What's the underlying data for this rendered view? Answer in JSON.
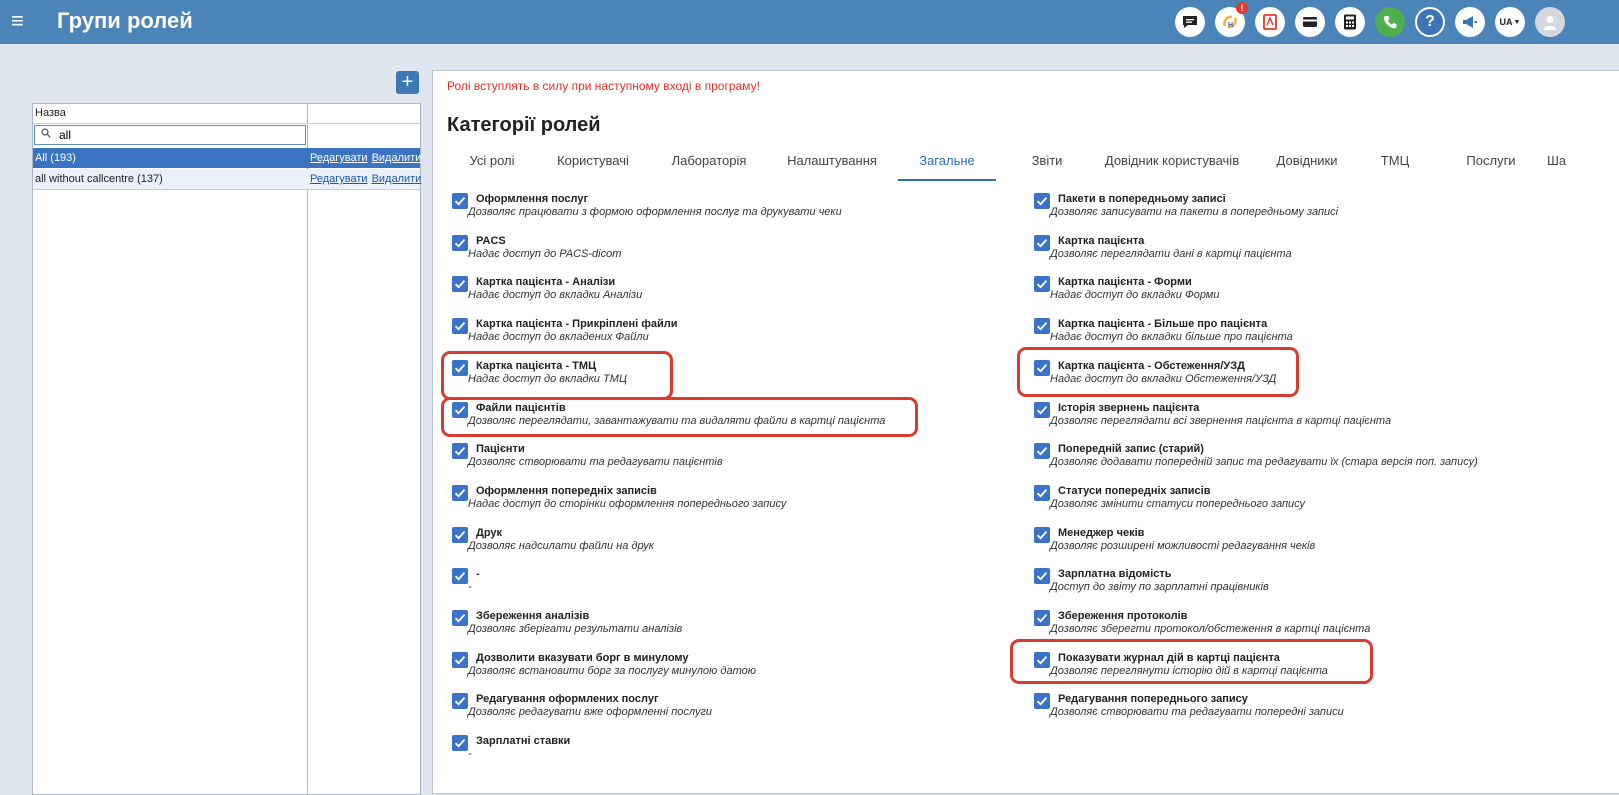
{
  "header": {
    "menu_icon": "≡",
    "title": "Групи ролей",
    "lang": "UA",
    "icons": [
      "chat-icon",
      "sync-icon",
      "pdf-icon",
      "card-icon",
      "calculator-icon",
      "phone-icon",
      "help-icon",
      "megaphone-icon",
      "language-icon",
      "avatar-icon"
    ],
    "sync_badge": "!"
  },
  "add_button": "+",
  "grid": {
    "column_name": "Назва",
    "filter_value": "all",
    "rows": [
      {
        "name": "All (193)",
        "edit": "Редагувати",
        "delete": "Видалити",
        "selected": true
      },
      {
        "name": "all without callcentre (137)",
        "edit": "Редагувати",
        "delete": "Видалити",
        "selected": false
      }
    ]
  },
  "panel": {
    "notice": "Ролі вступлять в силу при наступному вході в програму!",
    "title": "Категорії ролей",
    "tabs": [
      "Усі ролі",
      "Користувачі",
      "Лабораторія",
      "Налаштування",
      "Загальне",
      "Звіти",
      "Довідник користувачів",
      "Довідники",
      "ТМЦ",
      "Послуги",
      "Ша"
    ],
    "active_tab": "Загальне",
    "left_col": [
      {
        "title": "Оформлення послуг",
        "desc": "Дозволяє працювати з формою оформлення послуг та друкувати чеки"
      },
      {
        "title": "PACS",
        "desc": "Надає доступ до PACS-dicom"
      },
      {
        "title": "Картка пацієнта - Аналізи",
        "desc": "Надає доступ до вкладки Аналізи"
      },
      {
        "title": "Картка пацієнта - Прикріплені файли",
        "desc": "Надає доступ до вкладених Файли"
      },
      {
        "title": "Картка пацієнта - ТМЦ",
        "desc": "Надає доступ до вкладки ТМЦ"
      },
      {
        "title": "Файли пацієнтів",
        "desc": "Дозволяє переглядати, завантажувати та видаляти файли в картці пацієнта"
      },
      {
        "title": "Пацієнти",
        "desc": "Дозволяє створювати та редагувати пацієнтів"
      },
      {
        "title": "Оформлення попередніх записів",
        "desc": "Надає доступ до сторінки оформлення попереднього запису"
      },
      {
        "title": "Друк",
        "desc": "Дозволяє надсилати файли на друк"
      },
      {
        "title": "-",
        "desc": "-"
      },
      {
        "title": "Збереження аналізів",
        "desc": "Дозволяє зберігати результати аналізів"
      },
      {
        "title": "Дозволити вказувати борг в минулому",
        "desc": "Дозволяє встановити борг за послугу минулою датою"
      },
      {
        "title": "Редагування оформлених послуг",
        "desc": "Дозволяє редагувати вже оформленні послуги"
      },
      {
        "title": "Зарплатні ставки",
        "desc": "-"
      }
    ],
    "right_col": [
      {
        "title": "Пакети в попередньому записі",
        "desc": "Дозволяє записувати на пакети в попередньому записі"
      },
      {
        "title": "Картка пацієнта",
        "desc": "Дозволяє переглядати дані в картці пацієнта"
      },
      {
        "title": "Картка пацієнта - Форми",
        "desc": "Надає доступ до вкладки Форми"
      },
      {
        "title": "Картка пацієнта - Більше про пацієнта",
        "desc": "Надає доступ до вкладки більше про пацієнта"
      },
      {
        "title": "Картка пацієнта - Обстеження/УЗД",
        "desc": "Надає доступ до вкладки Обстеження/УЗД"
      },
      {
        "title": "Історія звернень пацієнта",
        "desc": "Дозволяє переглядати всі звернення пацієнта в картці пацієнта"
      },
      {
        "title": "Попередній запис (старий)",
        "desc": "Дозволяє додавати попередній запис та редагувати їх (стара версія поп. запису)"
      },
      {
        "title": "Статуси попередніх записів",
        "desc": "Дозволяє змінити статуси попереднього запису"
      },
      {
        "title": "Менеджер чеків",
        "desc": "Дозволяє розширені можливості редагування чеків"
      },
      {
        "title": "Зарплатна відомість",
        "desc": "Доступ до звіту по зарплатні працівників"
      },
      {
        "title": "Збереження протоколів",
        "desc": "Дозволяє зберегти протокол/обстеження в картці пацієнта"
      },
      {
        "title": "Показувати журнал дій в картці пацієнта",
        "desc": "Дозволяє переглянути історію дій в картці пацієнта"
      },
      {
        "title": "Редагування попереднього запису",
        "desc": "Дозволяє створювати та редагувати попередні записи"
      }
    ],
    "highlight_color": "#d93b30"
  }
}
